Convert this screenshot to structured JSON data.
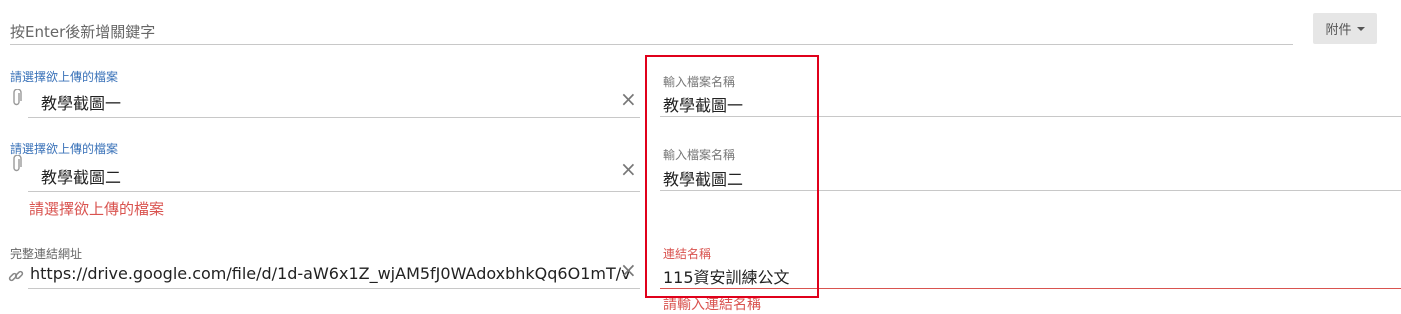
{
  "keyword_input": {
    "placeholder": "按Enter後新增關鍵字"
  },
  "attach_button": {
    "label": "附件"
  },
  "file_rows": [
    {
      "upload_label": "請選擇欲上傳的檔案",
      "file_value": "教學截圖一",
      "name_label": "輸入檔案名稱",
      "name_value": "教學截圖一"
    },
    {
      "upload_label": "請選擇欲上傳的檔案",
      "file_value": "教學截圖二",
      "error": "請選擇欲上傳的檔案",
      "name_label": "輸入檔案名稱",
      "name_value": "教學截圖二"
    }
  ],
  "link_row": {
    "url_label": "完整連結網址",
    "url_value": "https://drive.google.com/file/d/1d-aW6x1Z_wjAM5fJ0WAdoxbhkQq6O1mT/v",
    "name_label": "連結名稱",
    "name_value": "115資安訓練公文",
    "name_error": "請輸入連結名稱"
  },
  "colors": {
    "label_blue": "#3b73b9",
    "error_red": "#d9534f",
    "highlight_red": "#e0001b"
  }
}
